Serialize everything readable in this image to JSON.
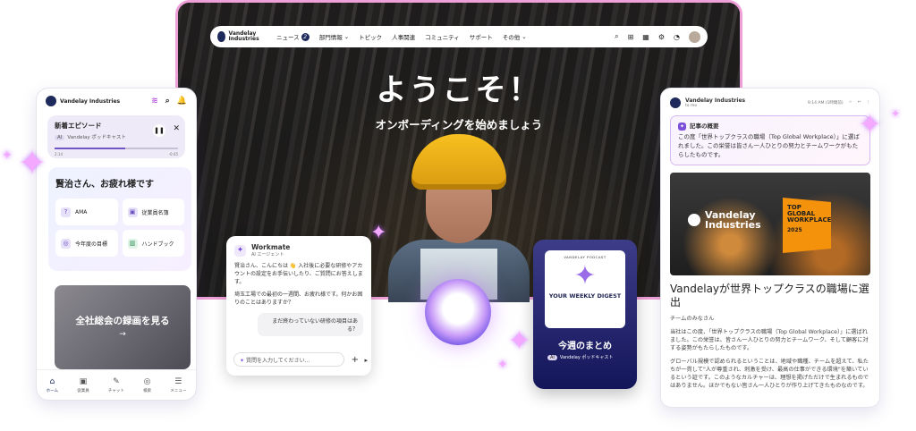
{
  "desktop": {
    "brand": "Vandelay Industries",
    "nav": [
      {
        "label": "ニュース",
        "badge": "2"
      },
      {
        "label": "部門情報"
      },
      {
        "label": "トピック"
      },
      {
        "label": "人事関連"
      },
      {
        "label": "コミュニティ"
      },
      {
        "label": "サポート"
      },
      {
        "label": "その他"
      }
    ],
    "hero_title": "ようこそ！",
    "hero_subtitle": "オンボーディングを始めましょう"
  },
  "mobile": {
    "brand": "Vandelay Industries",
    "podcast": {
      "title": "新着エピソード",
      "ai": "AI",
      "channel": "Vandelay ポッドキャスト",
      "elapsed": "2:14",
      "remaining": "-0:45",
      "progress": 0.57
    },
    "greeting": "賢治さん、お疲れ様です",
    "quick_links": [
      {
        "label": "AMA",
        "icon": "chat-question-icon"
      },
      {
        "label": "従業員名簿",
        "icon": "contacts-icon"
      },
      {
        "label": "今年度の目標",
        "icon": "target-icon"
      },
      {
        "label": "ハンドブック",
        "icon": "book-icon"
      }
    ],
    "video_title": "全社総会の録画を見る",
    "video_arrow": "→",
    "tabs": [
      {
        "label": "ホーム",
        "icon": "⌂"
      },
      {
        "label": "従業員",
        "icon": "▣"
      },
      {
        "label": "チャット",
        "icon": "✎"
      },
      {
        "label": "検索",
        "icon": "◎"
      },
      {
        "label": "メニュー",
        "icon": "☰"
      }
    ]
  },
  "chat": {
    "name": "Workmate",
    "role": "AI エージェント",
    "message1": "賢治さん、こんにちは 👋 入社後に必要な研修やアカウントの設定をお手伝いしたり、ご質問にお答えします。",
    "message2": "埼玉工場での最初の一週間、お疲れ様です。何かお困りのことはありますか？",
    "user_question": "まだ終わっていない研修の項目はある？",
    "input_placeholder": "質問を入力してください..."
  },
  "digest": {
    "brand": "VANDELAY PODCAST",
    "card_title": "YOUR WEEKLY DIGEST",
    "title": "今週のまとめ",
    "ai": "AI",
    "channel": "Vandelay ポッドキャスト"
  },
  "article": {
    "from": "Vandelay Industries",
    "to": "to me",
    "time": "9:14 AM (1時間前)",
    "summary_label": "記事の概要",
    "summary": "この度「世界トップクラスの職場（Top Global Workplace）」に選ばれました。この栄誉は皆さん一人ひとりの努力とチームワークがもたらしたものです。",
    "image_brand": "Vandelay Industries",
    "award": "TOP GLOBAL WORKPLACE",
    "award_year": "2025",
    "title": "Vandelayが世界トップクラスの職場に選出",
    "salutation": "チームのみなさん",
    "para1": "当社はこの度、「世界トップクラスの職場（Top Global Workplace）」に選ばれました。この栄誉は、皆さん一人ひとりの努力とチームワーク、そして顧客に対する姿勢がもたらしたものです。",
    "para2": "グローバル規模で認められるということは、地域や職種、チームを超えて、私たちが一貫して\"人が尊重され、刺激を受け、最高の仕事ができる環境\"を築いているという証です。このようなカルチャーは、理想を掲げただけで生まれるものではありません。ほかでもない皆さん一人ひとりが作り上げてきたものなのです。"
  }
}
